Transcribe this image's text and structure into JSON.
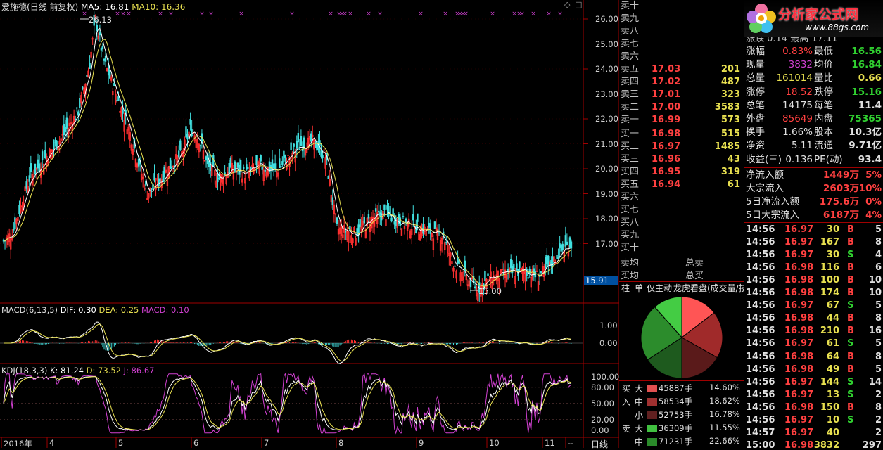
{
  "chart_header": {
    "name": "爱施德",
    "mode": "(日线 前复权)",
    "ma5": "MA5: 16.81",
    "ma10": "MA10: 16.36"
  },
  "annotations": {
    "high": "26.13",
    "low": "15.00",
    "current_price_tag": "15.91"
  },
  "macd_header": {
    "name": "MACD(6,13,5)",
    "dif": "DIF: 0.30",
    "dea": "DEA: 0.25",
    "macd": "MACD: 0.10"
  },
  "kdj_header": {
    "name": "KDJ(18,3,3)",
    "k": "K: 81.24",
    "d": "D: 73.52",
    "j": "J: 86.67"
  },
  "x_labels": [
    "2016年",
    "4",
    "5",
    "6",
    "7",
    "8",
    "9",
    "10",
    "11",
    "--"
  ],
  "period_button": "日线",
  "price_axis": [
    "26.00",
    "25.00",
    "24.00",
    "23.00",
    "22.00",
    "21.00",
    "20.00",
    "19.00",
    "18.00",
    "17.00"
  ],
  "macd_axis": [
    "1.00",
    "0.00"
  ],
  "kdj_axis": [
    "100.00",
    "80.00",
    "50.00",
    "20.00",
    "0.00"
  ],
  "order_book": {
    "sells": [
      {
        "label": "卖十",
        "price": "",
        "vol": ""
      },
      {
        "label": "卖九",
        "price": "",
        "vol": ""
      },
      {
        "label": "卖八",
        "price": "",
        "vol": ""
      },
      {
        "label": "卖七",
        "price": "",
        "vol": ""
      },
      {
        "label": "卖六",
        "price": "",
        "vol": ""
      },
      {
        "label": "卖五",
        "price": "17.03",
        "vol": "201"
      },
      {
        "label": "卖四",
        "price": "17.02",
        "vol": "487"
      },
      {
        "label": "卖三",
        "price": "17.01",
        "vol": "323"
      },
      {
        "label": "卖二",
        "price": "17.00",
        "vol": "3583"
      },
      {
        "label": "卖一",
        "price": "16.99",
        "vol": "573"
      }
    ],
    "buys": [
      {
        "label": "买一",
        "price": "16.98",
        "vol": "515"
      },
      {
        "label": "买二",
        "price": "16.97",
        "vol": "1485"
      },
      {
        "label": "买三",
        "price": "16.96",
        "vol": "43"
      },
      {
        "label": "买四",
        "price": "16.95",
        "vol": "319"
      },
      {
        "label": "买五",
        "price": "16.94",
        "vol": "61"
      },
      {
        "label": "买六",
        "price": "",
        "vol": ""
      },
      {
        "label": "买七",
        "price": "",
        "vol": ""
      },
      {
        "label": "买八",
        "price": "",
        "vol": ""
      },
      {
        "label": "买九",
        "price": "",
        "vol": ""
      },
      {
        "label": "买十",
        "price": "",
        "vol": ""
      }
    ],
    "avg_sell": "卖均",
    "total_sell": "总卖",
    "avg_buy": "买均",
    "total_buy": "总买"
  },
  "tabs": [
    "柱",
    "单",
    "仅主动",
    "龙虎看盘(成交量/技"
  ],
  "flow_table": [
    {
      "side": "买",
      "size": "大",
      "vol": "45887手",
      "pct": "14.60%",
      "color": "#e05050"
    },
    {
      "side": "入",
      "size": "中",
      "vol": "58534手",
      "pct": "18.62%",
      "color": "#a03030"
    },
    {
      "side": "",
      "size": "小",
      "vol": "52753手",
      "pct": "16.78%",
      "color": "#602020"
    },
    {
      "side": "卖",
      "size": "大",
      "vol": "36309手",
      "pct": "11.55%",
      "color": "#40c040"
    },
    {
      "side": "",
      "size": "中",
      "vol": "71231手",
      "pct": "22.66%",
      "color": "#2a8a2a"
    }
  ],
  "pie_data": [
    {
      "label": "买大",
      "value": 14.6,
      "color": "#ff5555"
    },
    {
      "label": "买中",
      "value": 18.62,
      "color": "#a02a2a"
    },
    {
      "label": "买小",
      "value": 16.78,
      "color": "#5a1a1a"
    },
    {
      "label": "卖小",
      "value": 15.79,
      "color": "#1e5a1e"
    },
    {
      "label": "卖中",
      "value": 22.66,
      "color": "#2c8c2c"
    },
    {
      "label": "卖大",
      "value": 11.55,
      "color": "#44cc44"
    }
  ],
  "logo": {
    "title": "分析家公式网",
    "url": "www.88gs.com"
  },
  "quote": {
    "partial_top": "涨跌 0.14 最高 17.11",
    "rows": [
      {
        "l1": "涨幅",
        "v1": "0.83%",
        "c1": "red",
        "l2": "最低",
        "v2": "16.56",
        "c2": "green"
      },
      {
        "l1": "现量",
        "v1": "3832",
        "c1": "purple",
        "l2": "均价",
        "v2": "16.84",
        "c2": "green"
      },
      {
        "l1": "总量",
        "v1": "161014",
        "c1": "yellow",
        "l2": "量比",
        "v2": "0.66",
        "c2": "yellow"
      },
      {
        "l1": "涨停",
        "v1": "18.52",
        "c1": "red",
        "l2": "跌停",
        "v2": "15.16",
        "c2": "green"
      },
      {
        "l1": "总笔",
        "v1": "14175",
        "c1": "white",
        "l2": "每笔",
        "v2": "11.4",
        "c2": "white"
      },
      {
        "l1": "外盘",
        "v1": "85649",
        "c1": "red",
        "l2": "内盘",
        "v2": "75365",
        "c2": "green"
      },
      {
        "l1": "换手",
        "v1": "1.66%",
        "c1": "white",
        "l2": "股本",
        "v2": "10.3亿",
        "c2": "white"
      },
      {
        "l1": "净资",
        "v1": "5.11",
        "c1": "white",
        "l2": "流通",
        "v2": "9.71亿",
        "c2": "white"
      },
      {
        "l1": "收益(三)",
        "v1": "0.136",
        "c1": "white",
        "l2": "PE(动)",
        "v2": "93.4",
        "c2": "white"
      }
    ],
    "flows": [
      {
        "label": "净流入额",
        "value": "1449万",
        "pct": "5%"
      },
      {
        "label": "大宗流入",
        "value": "2603万",
        "pct": "10%"
      },
      {
        "label": "5日净流入额",
        "value": "175.6万",
        "pct": "0%"
      },
      {
        "label": "5日大宗流入",
        "value": "6187万",
        "pct": "4%"
      }
    ]
  },
  "ticks": [
    {
      "t": "14:56",
      "p": "16.97",
      "pc": "red",
      "v": "30",
      "s": "B",
      "n": "5"
    },
    {
      "t": "14:56",
      "p": "16.97",
      "pc": "red",
      "v": "167",
      "s": "B",
      "n": "8"
    },
    {
      "t": "14:56",
      "p": "16.97",
      "pc": "red",
      "v": "30",
      "s": "S",
      "n": "4"
    },
    {
      "t": "14:56",
      "p": "16.98",
      "pc": "red",
      "v": "116",
      "s": "B",
      "n": "6"
    },
    {
      "t": "14:56",
      "p": "16.98",
      "pc": "red",
      "v": "100",
      "s": "B",
      "n": "10"
    },
    {
      "t": "14:56",
      "p": "16.98",
      "pc": "red",
      "v": "174",
      "s": "B",
      "n": "10"
    },
    {
      "t": "14:56",
      "p": "16.97",
      "pc": "red",
      "v": "67",
      "s": "S",
      "n": "5"
    },
    {
      "t": "14:56",
      "p": "16.98",
      "pc": "red",
      "v": "44",
      "s": "B",
      "n": "8"
    },
    {
      "t": "14:56",
      "p": "16.98",
      "pc": "red",
      "v": "210",
      "s": "B",
      "n": "16"
    },
    {
      "t": "14:56",
      "p": "16.97",
      "pc": "red",
      "v": "61",
      "s": "S",
      "n": "5"
    },
    {
      "t": "14:56",
      "p": "16.98",
      "pc": "red",
      "v": "64",
      "s": "B",
      "n": "8"
    },
    {
      "t": "14:56",
      "p": "16.98",
      "pc": "red",
      "v": "49",
      "s": "B",
      "n": "5"
    },
    {
      "t": "14:56",
      "p": "16.97",
      "pc": "red",
      "v": "144",
      "s": "S",
      "n": "14"
    },
    {
      "t": "14:56",
      "p": "16.97",
      "pc": "red",
      "v": "13",
      "s": "S",
      "n": "2"
    },
    {
      "t": "14:56",
      "p": "16.98",
      "pc": "red",
      "v": "150",
      "s": "B",
      "n": "8"
    },
    {
      "t": "14:56",
      "p": "16.97",
      "pc": "red",
      "v": "10",
      "s": "S",
      "n": "2"
    },
    {
      "t": "14:57",
      "p": "16.97",
      "pc": "red",
      "v": "40",
      "s": "",
      "n": "2"
    },
    {
      "t": "15:00",
      "p": "16.98",
      "pc": "red",
      "v": "3832",
      "s": "",
      "n": "297"
    }
  ]
}
